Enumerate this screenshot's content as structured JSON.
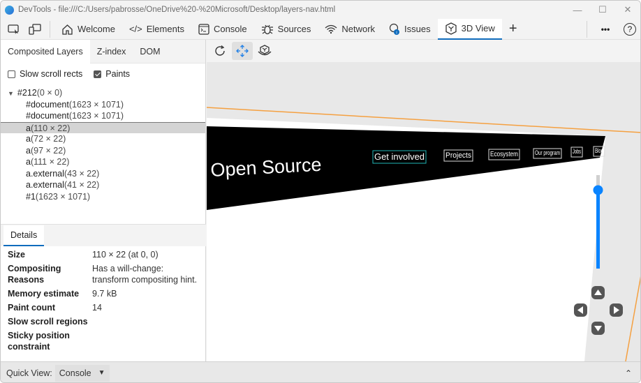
{
  "window": {
    "title": "DevTools - file:///C:/Users/pabrosse/OneDrive%20-%20Microsoft/Desktop/layers-nav.html",
    "controls": [
      "minimize",
      "maximize",
      "close"
    ]
  },
  "toolbar": {
    "tabs": [
      {
        "label": "Welcome",
        "icon": "home-icon"
      },
      {
        "label": "Elements",
        "icon": "code-icon"
      },
      {
        "label": "Console",
        "icon": "console-icon"
      },
      {
        "label": "Sources",
        "icon": "bug-icon"
      },
      {
        "label": "Network",
        "icon": "wifi-icon"
      },
      {
        "label": "Issues",
        "icon": "lightbulb-icon"
      },
      {
        "label": "3D View",
        "icon": "cube-icon",
        "active": true
      }
    ],
    "add_tab_label": "+",
    "more_label": "•••",
    "help_label": "?"
  },
  "left": {
    "subtabs": [
      "Composited Layers",
      "Z-index",
      "DOM"
    ],
    "active_subtab": "Composited Layers",
    "checkboxes": [
      {
        "label": "Slow scroll rects",
        "checked": false
      },
      {
        "label": "Paints",
        "checked": true
      }
    ],
    "tree": [
      {
        "name": "#212",
        "dims": "(0 × 0)",
        "root": true
      },
      {
        "name": "#document",
        "dims": "(1623 × 1071)"
      },
      {
        "name": "#document",
        "dims": "(1623 × 1071)"
      },
      {
        "name": "a",
        "dims": "(110 × 22)",
        "selected": true
      },
      {
        "name": "a",
        "dims": "(72 × 22)"
      },
      {
        "name": "a",
        "dims": "(97 × 22)"
      },
      {
        "name": "a",
        "dims": "(111 × 22)"
      },
      {
        "name": "a.external",
        "dims": "(43 × 22)"
      },
      {
        "name": "a.external",
        "dims": "(41 × 22)"
      },
      {
        "name": "#1",
        "dims": "(1623 × 1071)"
      }
    ],
    "details_tab": "Details",
    "details": [
      {
        "key": "Size",
        "value": "110 × 22 (at 0, 0)"
      },
      {
        "key": "Compositing Reasons",
        "value": "Has a will-change: transform compositing hint."
      },
      {
        "key": "Memory estimate",
        "value": "9.7 kB"
      },
      {
        "key": "Paint count",
        "value": "14"
      },
      {
        "key": "Slow scroll regions",
        "value": ""
      },
      {
        "key": "Sticky position constraint",
        "value": ""
      }
    ]
  },
  "viewport": {
    "tools": [
      "reset-view",
      "pan",
      "rotate"
    ],
    "active_tool": "pan",
    "page_heading": "Open Source",
    "nav_links": [
      "Get involved",
      "Projects",
      "Ecosystem",
      "Our program",
      "Jobs",
      "Blog"
    ],
    "zoom_level": 0.84,
    "highlight_color": "#1fb6b6",
    "accent_color": "#0a84ff",
    "border_color": "#f5a040"
  },
  "bottom": {
    "quick_view_label": "Quick View:",
    "quick_view_value": "Console"
  }
}
